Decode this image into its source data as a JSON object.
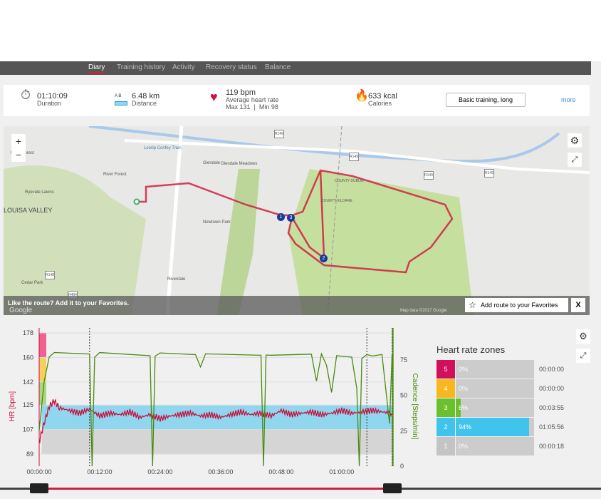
{
  "nav": {
    "tabs": [
      "Diary",
      "Training history",
      "Activity",
      "Recovery status",
      "Balance"
    ],
    "active": "Diary"
  },
  "summary": {
    "duration": {
      "value": "01:10:09",
      "label": "Duration"
    },
    "distance": {
      "value": "6.48 km",
      "label": "Distance",
      "icon_letters": "A B"
    },
    "heart_rate": {
      "value": "119 bpm",
      "label": "Average heart rate",
      "maxmin": "Max 131  |  Min 98"
    },
    "calories": {
      "value": "633 kcal",
      "label": "Calories"
    },
    "training_type": "Basic training, long",
    "more": "more"
  },
  "map": {
    "favorites_prompt": "Like the route?  Add it to your Favorites.",
    "add_favorite": "Add route to your Favorites",
    "close": "X",
    "credit": "Map data ©2017 Google",
    "zoom_in": "+",
    "zoom_out": "−",
    "labels": [
      "River Forest",
      "River Forest",
      "Ryevale Lawns",
      "LOUISA VALLEY",
      "Leixlip Confey Train",
      "Glendale",
      "Glendale Meadows",
      "R149",
      "R149",
      "R149",
      "R149",
      "Newtown Park",
      "R148",
      "Cedar Park",
      "R404",
      "Riverdale",
      "COUNTY KILDARE",
      "COUNTY DUBLIN",
      "Google"
    ],
    "markers": [
      "1",
      "2",
      "3"
    ]
  },
  "chart_data": {
    "type": "line",
    "x_ticks": [
      "00:00:00",
      "00:12:00",
      "00:24:00",
      "00:36:00",
      "00:48:00",
      "01:00:00"
    ],
    "xlim_min": [
      0,
      70.15
    ],
    "y_left": {
      "label": "HR [bpm]",
      "ticks": [
        89,
        107,
        125,
        142,
        160,
        178
      ],
      "range": [
        89,
        178
      ]
    },
    "y_right": {
      "label": "Cadence [Steps/min]",
      "ticks": [
        0,
        25,
        50,
        75
      ],
      "range": [
        0,
        75
      ]
    },
    "hr_zone_bands": [
      {
        "from": 107,
        "to": 125,
        "color": "#8fd6ee"
      },
      {
        "from": 89,
        "to": 107,
        "color": "#d5d5d5"
      }
    ],
    "markers_min": [
      10,
      65,
      70
    ],
    "series": [
      {
        "name": "HR",
        "color": "#c8103c",
        "t": [
          0,
          1,
          2,
          3,
          4,
          6,
          8,
          10,
          12,
          14,
          16,
          18,
          20,
          22,
          24,
          26,
          28,
          30,
          32,
          34,
          36,
          38,
          40,
          42,
          44,
          46,
          48,
          50,
          52,
          54,
          56,
          58,
          60,
          62,
          64,
          66,
          68,
          70
        ],
        "values": [
          98,
          112,
          124,
          128,
          123,
          121,
          119,
          122,
          117,
          119,
          118,
          120,
          116,
          118,
          115,
          117,
          118,
          119,
          117,
          118,
          116,
          118,
          120,
          118,
          119,
          117,
          121,
          118,
          119,
          120,
          118,
          119,
          121,
          119,
          120,
          121,
          120,
          119
        ]
      },
      {
        "name": "Cadence",
        "color": "#4a8a10",
        "t": [
          0,
          1,
          2,
          3,
          10,
          10.5,
          11,
          12,
          22,
          22.5,
          23,
          24,
          31,
          32,
          33,
          44,
          44.5,
          45,
          46,
          54,
          55,
          56,
          57,
          58,
          59,
          60,
          62,
          63,
          63.5,
          64,
          65,
          66,
          68,
          69.5,
          70
        ],
        "values": [
          25,
          60,
          78,
          79,
          78,
          0,
          78,
          79,
          78,
          0,
          78,
          79,
          78,
          70,
          78,
          78,
          0,
          78,
          79,
          78,
          60,
          78,
          72,
          52,
          78,
          78,
          78,
          55,
          0,
          77,
          78,
          78,
          78,
          30,
          78
        ]
      }
    ]
  },
  "zones": {
    "title": "Heart rate zones",
    "rows": [
      {
        "zone": "5",
        "pct": "0%",
        "pct_value": 0,
        "time": "00:00:00",
        "color": "#d0105a"
      },
      {
        "zone": "4",
        "pct": "0%",
        "pct_value": 0,
        "time": "00:00:00",
        "color": "#f5b820"
      },
      {
        "zone": "3",
        "pct": "6%",
        "pct_value": 6,
        "time": "00:03:55",
        "color": "#6cc030"
      },
      {
        "zone": "2",
        "pct": "94%",
        "pct_value": 94,
        "time": "01:05:56",
        "color": "#40c4ec"
      },
      {
        "zone": "1",
        "pct": "0%",
        "pct_value": 0,
        "time": "00:00:18",
        "color": "#c4c4c4"
      }
    ]
  }
}
